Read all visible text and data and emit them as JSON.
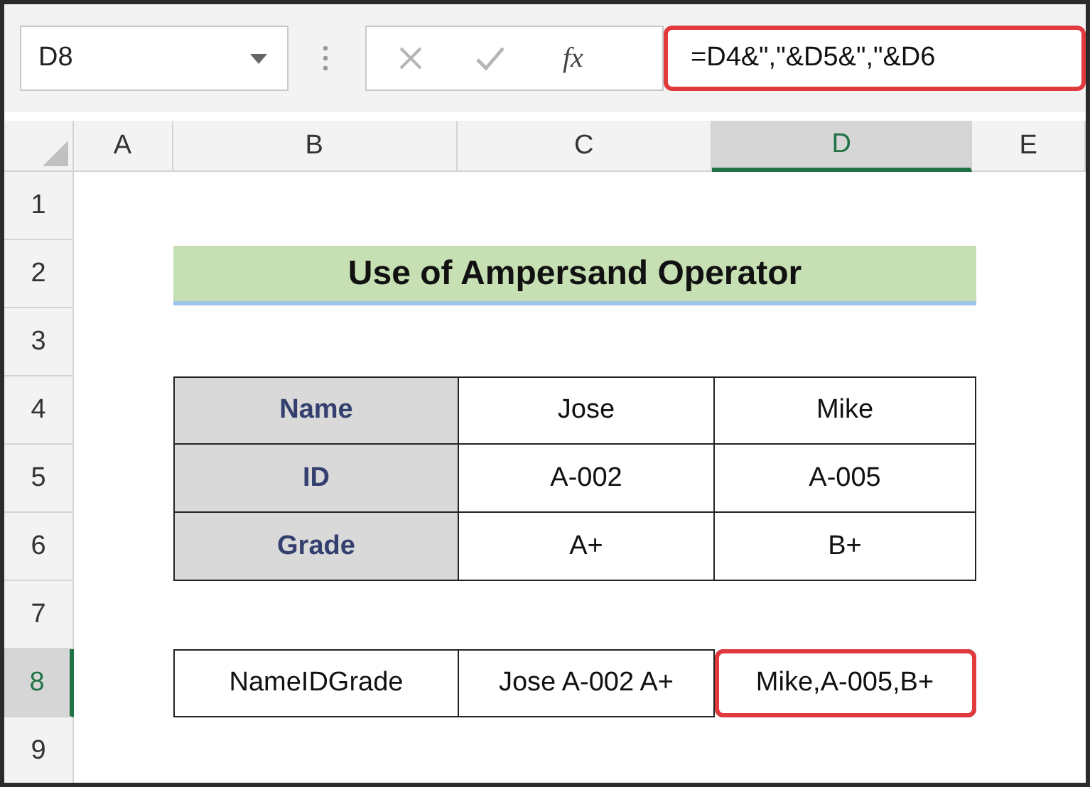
{
  "name_box": {
    "value": "D8"
  },
  "function_label": "fx",
  "formula_bar": {
    "value": "=D4&\",\"&D5&\",\"&D6",
    "highlighted": true
  },
  "columns": [
    {
      "label": "A",
      "selected": false
    },
    {
      "label": "B",
      "selected": false
    },
    {
      "label": "C",
      "selected": false
    },
    {
      "label": "D",
      "selected": true
    },
    {
      "label": "E",
      "selected": false
    }
  ],
  "rows": [
    {
      "label": "1",
      "selected": false
    },
    {
      "label": "2",
      "selected": false
    },
    {
      "label": "3",
      "selected": false
    },
    {
      "label": "4",
      "selected": false
    },
    {
      "label": "5",
      "selected": false
    },
    {
      "label": "6",
      "selected": false
    },
    {
      "label": "7",
      "selected": false
    },
    {
      "label": "8",
      "selected": true
    },
    {
      "label": "9",
      "selected": false
    }
  ],
  "title": "Use of Ampersand Operator",
  "table": [
    {
      "header": "Name",
      "values": [
        "Jose",
        "Mike"
      ]
    },
    {
      "header": "ID",
      "values": [
        "A-002",
        "A-005"
      ]
    },
    {
      "header": "Grade",
      "values": [
        "A+",
        "B+"
      ]
    }
  ],
  "result_row": [
    {
      "text": "NameIDGrade",
      "highlighted": false
    },
    {
      "text": "Jose A-002 A+",
      "highlighted": false
    },
    {
      "text": "Mike,A-005,B+",
      "highlighted": true
    }
  ]
}
